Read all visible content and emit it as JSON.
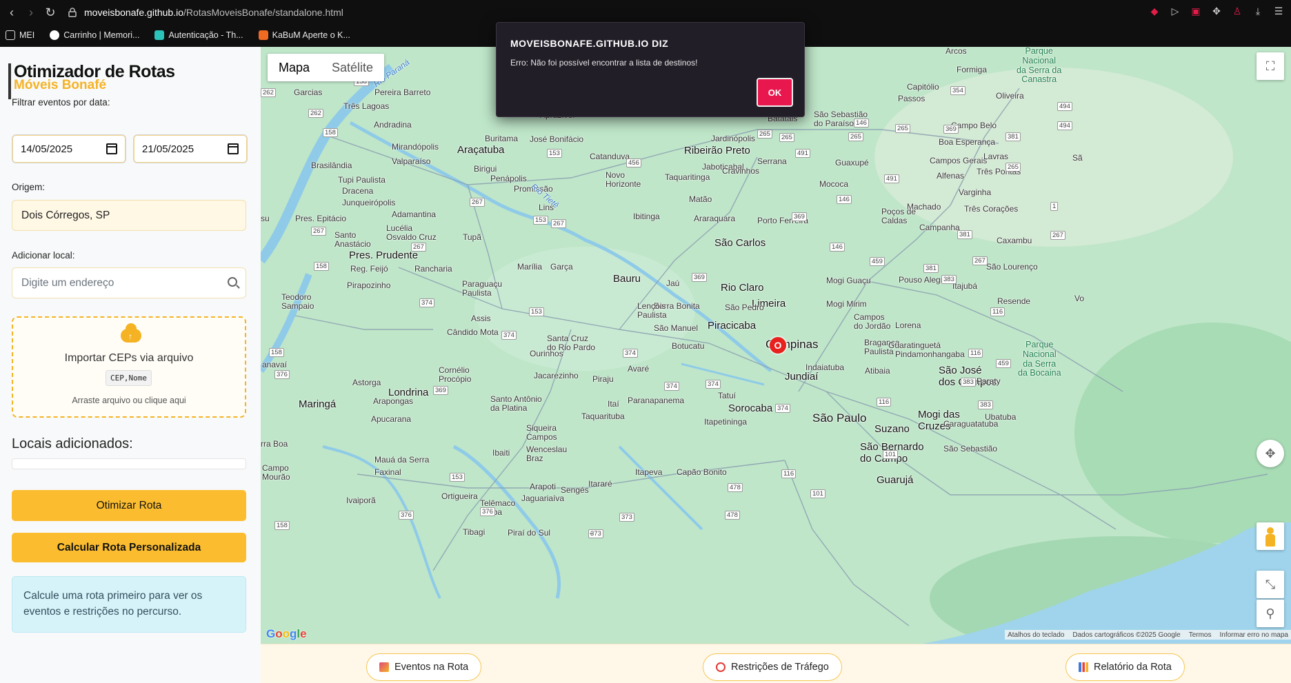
{
  "browser": {
    "url_host": "moveisbonafe.github.io",
    "url_path": "/RotasMoveisBonafe/standalone.html",
    "bookmarks": [
      {
        "label": "MEI"
      },
      {
        "label": "Carrinho | Memori..."
      },
      {
        "label": "Autenticação - Th..."
      },
      {
        "label": "KaBuM Aperte o K..."
      }
    ]
  },
  "sidebar": {
    "title": "Otimizador de Rotas",
    "subtitle": "Móveis Bonafé",
    "filter_label": "Filtrar eventos por data:",
    "date_start": "14/05/2025",
    "date_end": "21/05/2025",
    "origin_label": "Origem:",
    "origin_value": "Dois Córregos, SP",
    "add_label": "Adicionar local:",
    "add_placeholder": "Digite um endereço",
    "import_title": "Importar CEPs via arquivo",
    "import_format": "CEP,Nome",
    "import_hint": "Arraste arquivo ou clique aqui",
    "locations_title": "Locais adicionados:",
    "optimize_button": "Otimizar Rota",
    "custom_button": "Calcular Rota Personalizada",
    "info_text": "Calcule uma rota primeiro para ver os eventos e restrições no percurso."
  },
  "map": {
    "type_map": "Mapa",
    "type_satellite": "Satélite",
    "marker_label": "O",
    "attribution": [
      "Atalhos do teclado",
      "Dados cartográficos ©2025 Google",
      "Termos",
      "Informar erro no mapa"
    ],
    "google_logo": "Google"
  },
  "bottom_tabs": [
    {
      "label": "Eventos na Rota"
    },
    {
      "label": "Restrições de Tráfego"
    },
    {
      "label": "Relatório da Rota"
    }
  ],
  "dialog": {
    "title": "MOVEISBONAFE.GITHUB.IO DIZ",
    "message": "Erro: Não foi possível encontrar a lista de destinos!",
    "ok_label": "OK"
  },
  "colors": {
    "accent": "#fbbd2f",
    "dialog_button": "#e8174e",
    "marker": "#e8201e"
  }
}
